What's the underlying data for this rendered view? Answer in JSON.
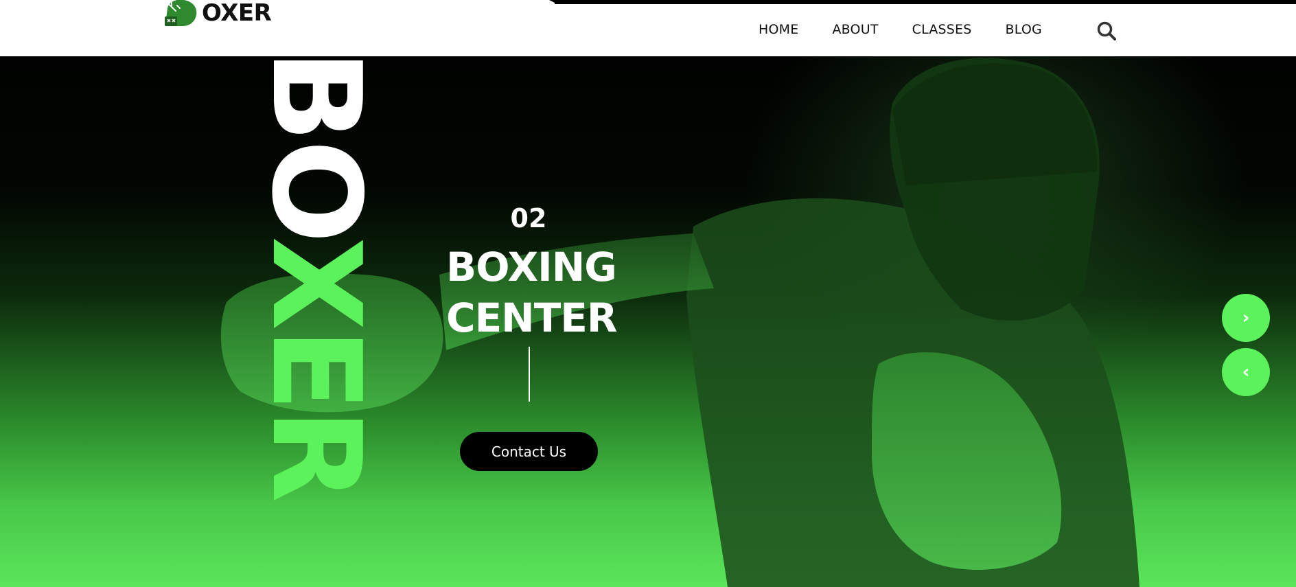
{
  "brand": {
    "name": "OXER"
  },
  "nav": {
    "items": [
      {
        "label": "HOME"
      },
      {
        "label": "ABOUT"
      },
      {
        "label": "CLASSES"
      },
      {
        "label": "BLOG"
      }
    ],
    "search_icon": "search-icon"
  },
  "hero": {
    "vertical_word_white": "BO",
    "vertical_word_green": "XER",
    "slide_number": "02",
    "title_line1": "BOXING",
    "title_line2": "CENTER",
    "cta_label": "Contact Us",
    "next_icon": "chevron-right-icon",
    "prev_icon": "chevron-left-icon",
    "next_glyph": "›",
    "prev_glyph": "‹"
  },
  "colors": {
    "accent": "#5cf25c",
    "header_bg": "#ffffff",
    "text_dark": "#111111",
    "button_bg": "#000000"
  }
}
